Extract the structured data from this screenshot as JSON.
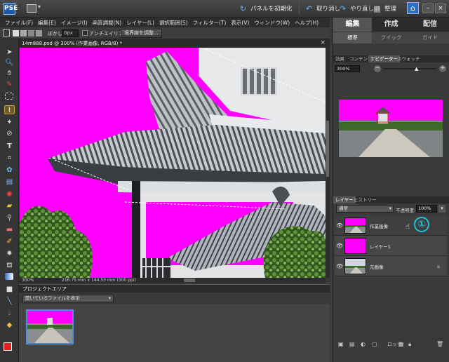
{
  "topbar": {
    "app_icon_label": "PSE",
    "reset_panels": "パネルを初期化",
    "undo": "取り消し",
    "redo": "やり直し",
    "organize": "整理"
  },
  "menu": [
    "ファイル(F)",
    "編集(E)",
    "イメージ(I)",
    "画質調整(N)",
    "レイヤー(L)",
    "選択範囲(S)",
    "フィルター(T)",
    "表示(V)",
    "ウィンドウ(W)",
    "ヘルプ(H)"
  ],
  "options": {
    "feather_label": "ぼかし:",
    "feather_value": "0px",
    "antialias_label": "アンチエイリアス",
    "refine_button": "境界線を調整..."
  },
  "document": {
    "tab_label": "14m888.psd @ 300% (作業画像, RGB/8) *",
    "zoom": "300%",
    "doc_info": "216.75 mm x 144.53 mm (300 ppi)"
  },
  "project": {
    "header": "プロジェクトエリア",
    "select_value": "開いているファイルを表示"
  },
  "right_panel": {
    "mode_tabs": [
      "編集",
      "作成",
      "配信"
    ],
    "sub_tabs": [
      "標準",
      "クイック",
      "ガイド"
    ],
    "panel_tabs": [
      "効果",
      "コンテンツ",
      "ナビゲーター",
      "スウォッチ"
    ],
    "navigator_zoom": "300%",
    "layer_tabs": [
      "レイヤー",
      "ヒストリー"
    ],
    "blend_mode": "通常",
    "opacity_label": "不透明度:",
    "opacity_value": "100%",
    "layers": [
      {
        "name": "作業画像"
      },
      {
        "name": "レイヤー1"
      },
      {
        "name": "元画像"
      }
    ],
    "callout": "①",
    "lock_label": "ロック"
  },
  "colors": {
    "magenta": "#ff00ff",
    "accent_blue": "#4d8fd8",
    "callout_cyan": "#1ec3d8"
  }
}
